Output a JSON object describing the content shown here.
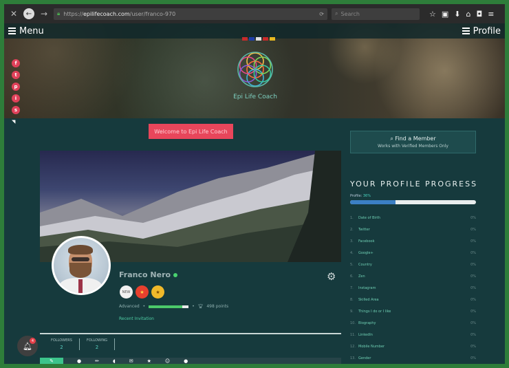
{
  "browser": {
    "url_prefix": "https://",
    "url_domain": "epilifecoach.com",
    "url_path": "/user/franco-970",
    "search_placeholder": "Search"
  },
  "topnav": {
    "menu_label": "Menu",
    "profile_label": "Profile"
  },
  "site": {
    "logo_text": "Epi Life Coach"
  },
  "social": [
    "f",
    "t",
    "p",
    "i",
    "s"
  ],
  "welcome_button": "Welcome to Epi Life Coach",
  "user": {
    "name": "Franco Nero",
    "level": "Advanced",
    "level_progress": 0.85,
    "points": "498 points",
    "recent_link": "Recent Invitation",
    "badges": [
      "NEW",
      "★",
      "★"
    ],
    "followers_label": "FOLLOWERS",
    "followers_count": "2",
    "following_label": "FOLLOWING",
    "following_count": "2",
    "notifications": "4"
  },
  "find_member": {
    "title": "Find a Member",
    "subtitle": "Works with Verified Members Only"
  },
  "profile_progress": {
    "title": "YOUR PROFILE PROGRESS",
    "label": "Profile:",
    "percent_text": "36%",
    "percent": 36,
    "items": [
      {
        "n": "1.",
        "label": "Date of Birth",
        "pct": "0%"
      },
      {
        "n": "2.",
        "label": "Twitter",
        "pct": "0%"
      },
      {
        "n": "3.",
        "label": "Facebook",
        "pct": "0%"
      },
      {
        "n": "4.",
        "label": "Google+",
        "pct": "0%"
      },
      {
        "n": "5.",
        "label": "Country",
        "pct": "0%"
      },
      {
        "n": "6.",
        "label": "Zen",
        "pct": "0%"
      },
      {
        "n": "7.",
        "label": "Instagram",
        "pct": "0%"
      },
      {
        "n": "8.",
        "label": "Skilled Area",
        "pct": "0%"
      },
      {
        "n": "9.",
        "label": "Things I do or I like",
        "pct": "0%"
      },
      {
        "n": "10.",
        "label": "Biography",
        "pct": "0%"
      },
      {
        "n": "11.",
        "label": "LinkedIn",
        "pct": "0%"
      },
      {
        "n": "12.",
        "label": "Mobile Number",
        "pct": "0%"
      },
      {
        "n": "13.",
        "label": "Gender",
        "pct": "0%"
      }
    ]
  },
  "colors": {
    "accent": "#e8465b",
    "panel": "#163a3d",
    "teal": "#4ad6c0"
  }
}
